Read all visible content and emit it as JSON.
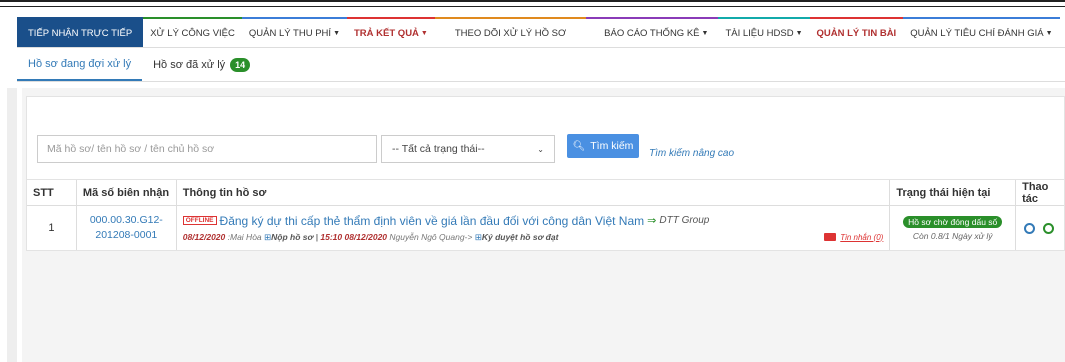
{
  "nav": {
    "items": [
      {
        "label": "TIẾP NHẬN TRỰC TIẾP",
        "caret": false
      },
      {
        "label": "XỬ LÝ CÔNG VIỆC",
        "caret": false
      },
      {
        "label": "QUẢN LÝ THU PHÍ",
        "caret": true
      },
      {
        "label": "TRẢ KẾT QUẢ",
        "caret": true
      },
      {
        "label": "THEO DÕI XỬ LÝ HỒ SƠ",
        "caret": false
      },
      {
        "label": "BÁO CÁO THỐNG KÊ",
        "caret": true
      },
      {
        "label": "TÀI LIỆU HDSD",
        "caret": true
      },
      {
        "label": "QUẢN LÝ TIN BÀI",
        "caret": false
      },
      {
        "label": "QUẢN LÝ TIÊU CHÍ ĐÁNH GIÁ",
        "caret": true
      }
    ]
  },
  "tabs": {
    "pending": "Hồ sơ đang đợi xử lý",
    "processed": "Hồ sơ đã xử lý",
    "processed_count": "14"
  },
  "search": {
    "placeholder": "Mã hồ sơ/ tên hồ sơ / tên chủ hồ sơ",
    "status_selected": "-- Tất cả trạng thái--",
    "button": "Tìm kiếm",
    "advanced": "Tìm kiếm nâng cao"
  },
  "table": {
    "headers": [
      "STT",
      "Mã số biên nhận",
      "Thông tin hồ sơ",
      "Trạng thái hiện tại",
      "Thao tác"
    ],
    "rows": [
      {
        "stt": "1",
        "code_line1": "000.00.30.G12-",
        "code_line2": "201208-0001",
        "tag": "OFFLINE",
        "title": "Đăng ký dự thi cấp thẻ thẩm định viên về giá lần đầu đối với công dân Việt Nam",
        "org": "DTT Group",
        "date1": "08/12/2020",
        "user1": ":Mai Hòa",
        "action1": "Nộp hồ sơ",
        "sep": "|",
        "date2": "15:10 08/12/2020",
        "user2": "Nguyễn Ngô Quang->",
        "action2": "Ký duyệt hồ sơ đạt",
        "messages": "Tin nhắn (0)",
        "status": "Hồ sơ chờ đóng dấu số",
        "remaining": "Còn 0.8/1 Ngày xử lý"
      }
    ]
  }
}
